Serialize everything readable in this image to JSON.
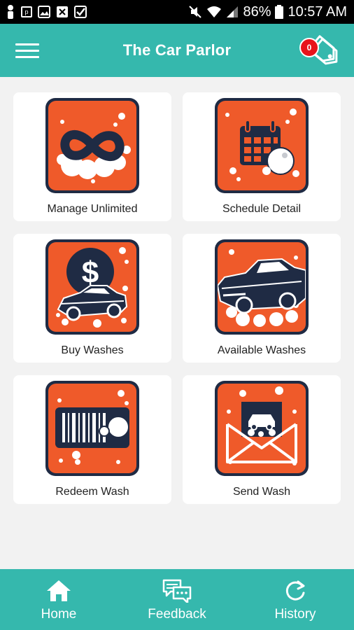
{
  "status_bar": {
    "battery": "86%",
    "time": "10:57 AM"
  },
  "app_bar": {
    "title": "The Car Parlor",
    "cart_count": "0",
    "menu_icon": "hamburger-menu-icon",
    "cart_icon": "price-tag-icon"
  },
  "tiles": [
    {
      "label": "Manage Unlimited",
      "icon": "infinity-icon"
    },
    {
      "label": "Schedule Detail",
      "icon": "calendar-icon"
    },
    {
      "label": "Buy Washes",
      "icon": "dollar-car-icon"
    },
    {
      "label": "Available Washes",
      "icon": "classic-car-icon"
    },
    {
      "label": "Redeem Wash",
      "icon": "barcode-icon"
    },
    {
      "label": "Send Wash",
      "icon": "envelope-car-icon"
    }
  ],
  "bottom_nav": [
    {
      "label": "Home",
      "icon": "home-icon"
    },
    {
      "label": "Feedback",
      "icon": "chat-bubbles-icon"
    },
    {
      "label": "History",
      "icon": "refresh-icon"
    }
  ],
  "colors": {
    "primary": "#35b8ad",
    "tile_orange": "#ef5a2a",
    "tile_navy": "#1f2b44",
    "badge_red": "#e8131b"
  }
}
